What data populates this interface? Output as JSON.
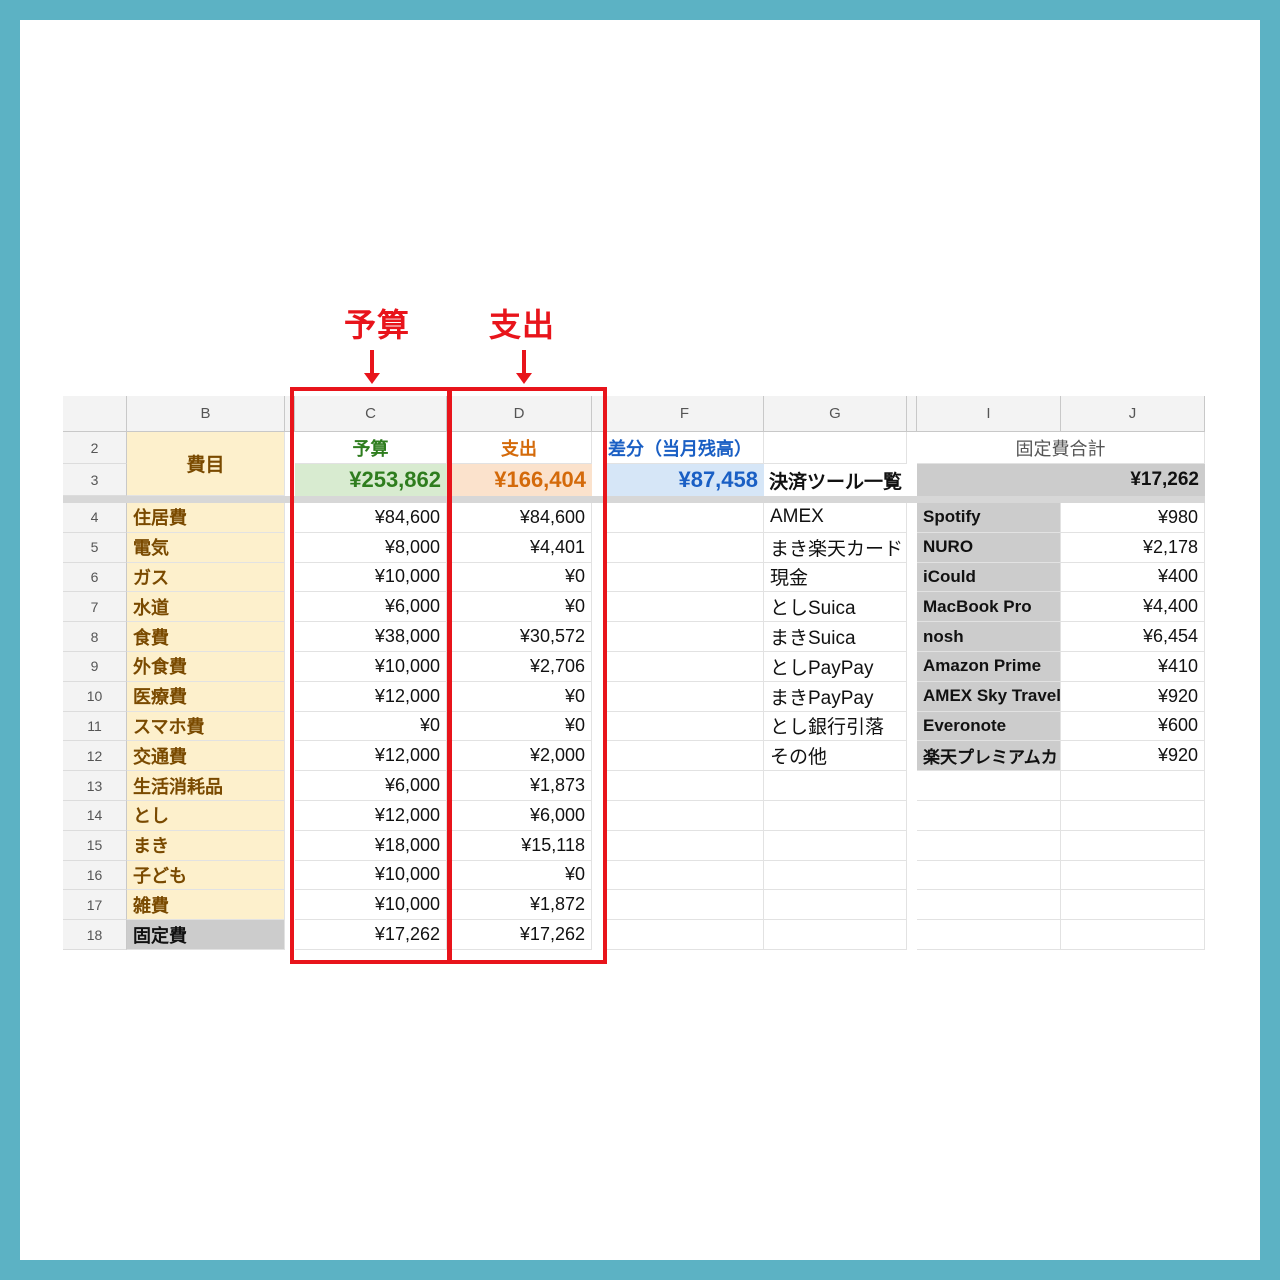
{
  "callouts": {
    "budget": "予算",
    "expense": "支出"
  },
  "columns": [
    "B",
    "C",
    "D",
    "F",
    "G",
    "I",
    "J"
  ],
  "header": {
    "b_label": "費目",
    "c_label": "予算",
    "d_label": "支出",
    "f_label": "差分（当月残高）",
    "ij_label": "固定費合計",
    "c_total": "¥253,862",
    "d_total": "¥166,404",
    "f_total": "¥87,458",
    "g_label": "決済ツール一覧",
    "ij_total": "¥17,262"
  },
  "header_rows": [
    "2",
    "3"
  ],
  "rows": [
    {
      "n": "4",
      "cat": "住居費",
      "budget": "¥84,600",
      "spent": "¥84,600"
    },
    {
      "n": "5",
      "cat": "電気",
      "budget": "¥8,000",
      "spent": "¥4,401"
    },
    {
      "n": "6",
      "cat": "ガス",
      "budget": "¥10,000",
      "spent": "¥0"
    },
    {
      "n": "7",
      "cat": "水道",
      "budget": "¥6,000",
      "spent": "¥0"
    },
    {
      "n": "8",
      "cat": "食費",
      "budget": "¥38,000",
      "spent": "¥30,572"
    },
    {
      "n": "9",
      "cat": "外食費",
      "budget": "¥10,000",
      "spent": "¥2,706"
    },
    {
      "n": "10",
      "cat": "医療費",
      "budget": "¥12,000",
      "spent": "¥0"
    },
    {
      "n": "11",
      "cat": "スマホ費",
      "budget": "¥0",
      "spent": "¥0"
    },
    {
      "n": "12",
      "cat": "交通費",
      "budget": "¥12,000",
      "spent": "¥2,000"
    },
    {
      "n": "13",
      "cat": "生活消耗品",
      "budget": "¥6,000",
      "spent": "¥1,873"
    },
    {
      "n": "14",
      "cat": "とし",
      "budget": "¥12,000",
      "spent": "¥6,000"
    },
    {
      "n": "15",
      "cat": "まき",
      "budget": "¥18,000",
      "spent": "¥15,118"
    },
    {
      "n": "16",
      "cat": "子ども",
      "budget": "¥10,000",
      "spent": "¥0"
    },
    {
      "n": "17",
      "cat": "雑費",
      "budget": "¥10,000",
      "spent": "¥1,872"
    },
    {
      "n": "18",
      "cat": "固定費",
      "budget": "¥17,262",
      "spent": "¥17,262"
    }
  ],
  "payment_tools": [
    "AMEX",
    "まき楽天カード",
    "現金",
    "としSuica",
    "まきSuica",
    "としPayPay",
    "まきPayPay",
    "とし銀行引落",
    "その他"
  ],
  "fixed_costs": [
    {
      "name": "Spotify",
      "amount": "¥980"
    },
    {
      "name": "NURO",
      "amount": "¥2,178"
    },
    {
      "name": "iCould",
      "amount": "¥400"
    },
    {
      "name": "MacBook Pro",
      "amount": "¥4,400"
    },
    {
      "name": "nosh",
      "amount": "¥6,454"
    },
    {
      "name": "Amazon Prime",
      "amount": "¥410"
    },
    {
      "name": "AMEX Sky Travel",
      "amount": "¥920"
    },
    {
      "name": "Everonote",
      "amount": "¥600"
    },
    {
      "name": "楽天プレミアムカ",
      "amount": "¥920"
    }
  ],
  "colors": {
    "frame": "#5cb2c4",
    "callout_red": "#e8141b",
    "budget_green": "#2e7d1e",
    "budget_fill": "#d8ebd0",
    "expense_orange": "#d46a0a",
    "expense_fill": "#fbe2cc",
    "diff_blue": "#1a5fc4",
    "diff_fill": "#d6e6f7",
    "category_fill": "#fdf0cc",
    "fixed_gray": "#cccccc"
  }
}
